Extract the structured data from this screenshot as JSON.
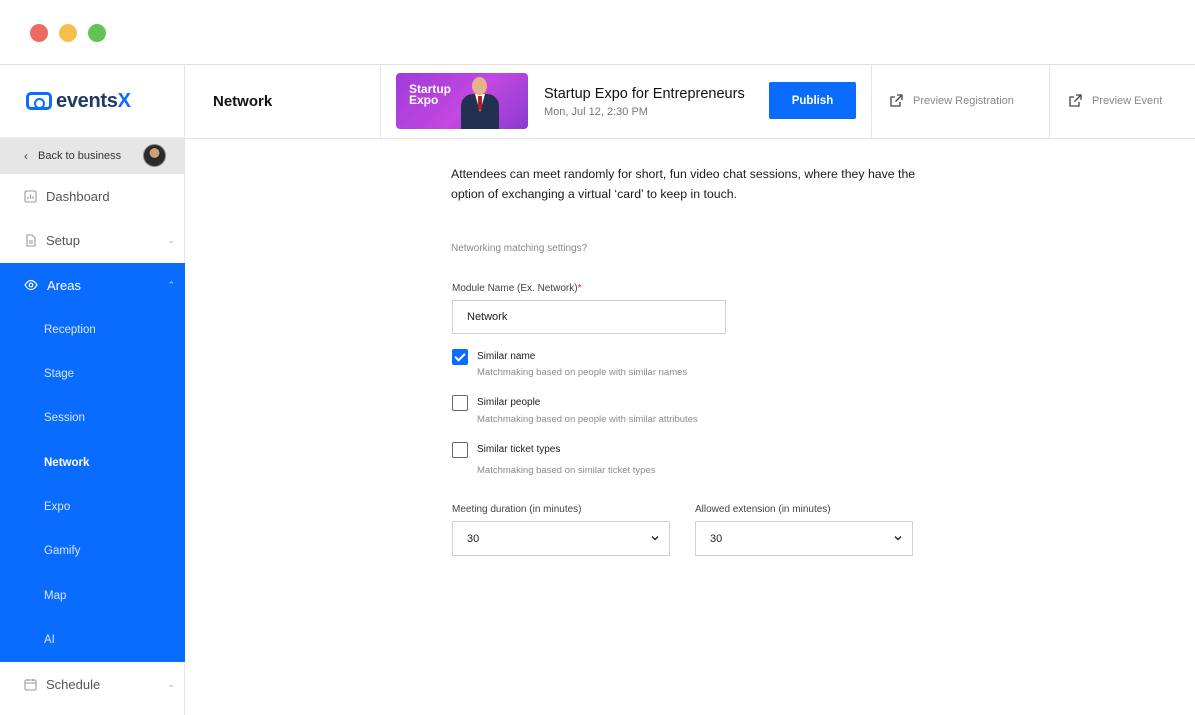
{
  "window": {
    "controls": [
      "close",
      "minimize",
      "maximize"
    ]
  },
  "brand": {
    "name_main": "events",
    "name_accent": "X",
    "accent_color": "#0a6cff"
  },
  "sidebar": {
    "back_label": "Back to business",
    "dashboard": "Dashboard",
    "setup": "Setup",
    "areas": "Areas",
    "area_items": [
      "Reception",
      "Stage",
      "Session",
      "Network",
      "Expo",
      "Gamify",
      "Map",
      "AI"
    ],
    "active_area": "Network",
    "schedule": "Schedule"
  },
  "header": {
    "page_title": "Network",
    "event_thumb_title_1": "Startup",
    "event_thumb_title_2": "Expo",
    "event_name": "Startup Expo for Entrepreneurs",
    "event_date": "Mon, Jul 12, 2:30 PM",
    "publish_label": "Publish",
    "preview_registration": "Preview Registration",
    "preview_event": "Preview Event"
  },
  "main": {
    "intro": "Attendees can meet randomly for short, fun video chat sessions, where they have the option of exchanging a virtual ‘card’ to keep in touch.",
    "settings_label": "Networking matching settings?",
    "module_name_label": "Module Name (Ex. Network)",
    "module_name_required": "*",
    "module_name_value": "Network",
    "options": [
      {
        "title": "Similar name",
        "desc": "Matchmaking based on people with similar names",
        "checked": true
      },
      {
        "title": "Similar people",
        "desc": "Matchmaking based on people with similar attributes",
        "checked": false
      },
      {
        "title": "Similar ticket types",
        "desc": "Matchmaking based on similar ticket types",
        "checked": false
      }
    ],
    "meeting_duration_label": "Meeting duration (in minutes)",
    "meeting_duration_value": "30",
    "allowed_extension_label": "Allowed extension (in minutes)",
    "allowed_extension_value": "30"
  }
}
